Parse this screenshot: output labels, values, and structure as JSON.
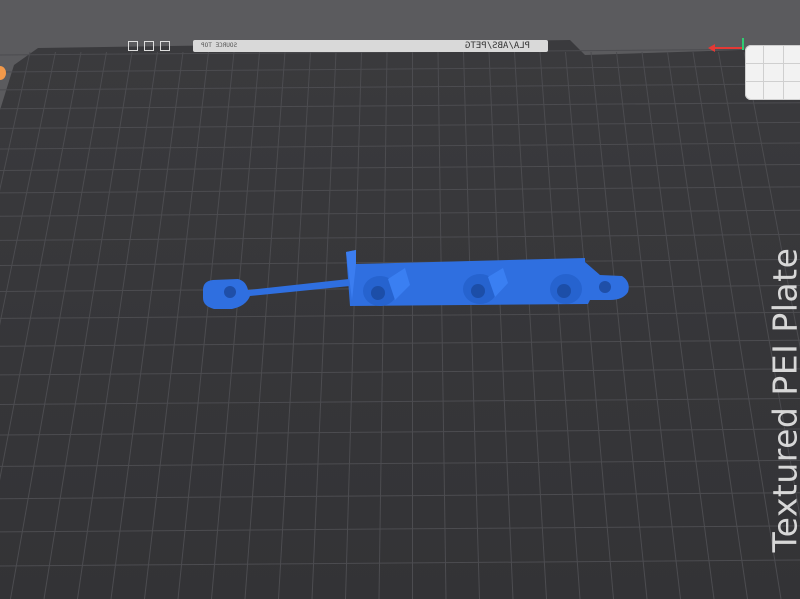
{
  "plate": {
    "label": "Textured PEI Plate",
    "top_strip_text": "PLA/ABS/PETG",
    "top_strip_sub": "SOURCE TOP"
  },
  "colors": {
    "background": "#5b5b5e",
    "plate": "#38383b",
    "grid": "#4e4e52",
    "model": "#2f6fe0",
    "axis_x": "#e53935",
    "axis_y": "#2ecc71"
  },
  "icons": {
    "nav_cube": "view-cube-icon",
    "plate_tools": "plate-tools-icon"
  }
}
